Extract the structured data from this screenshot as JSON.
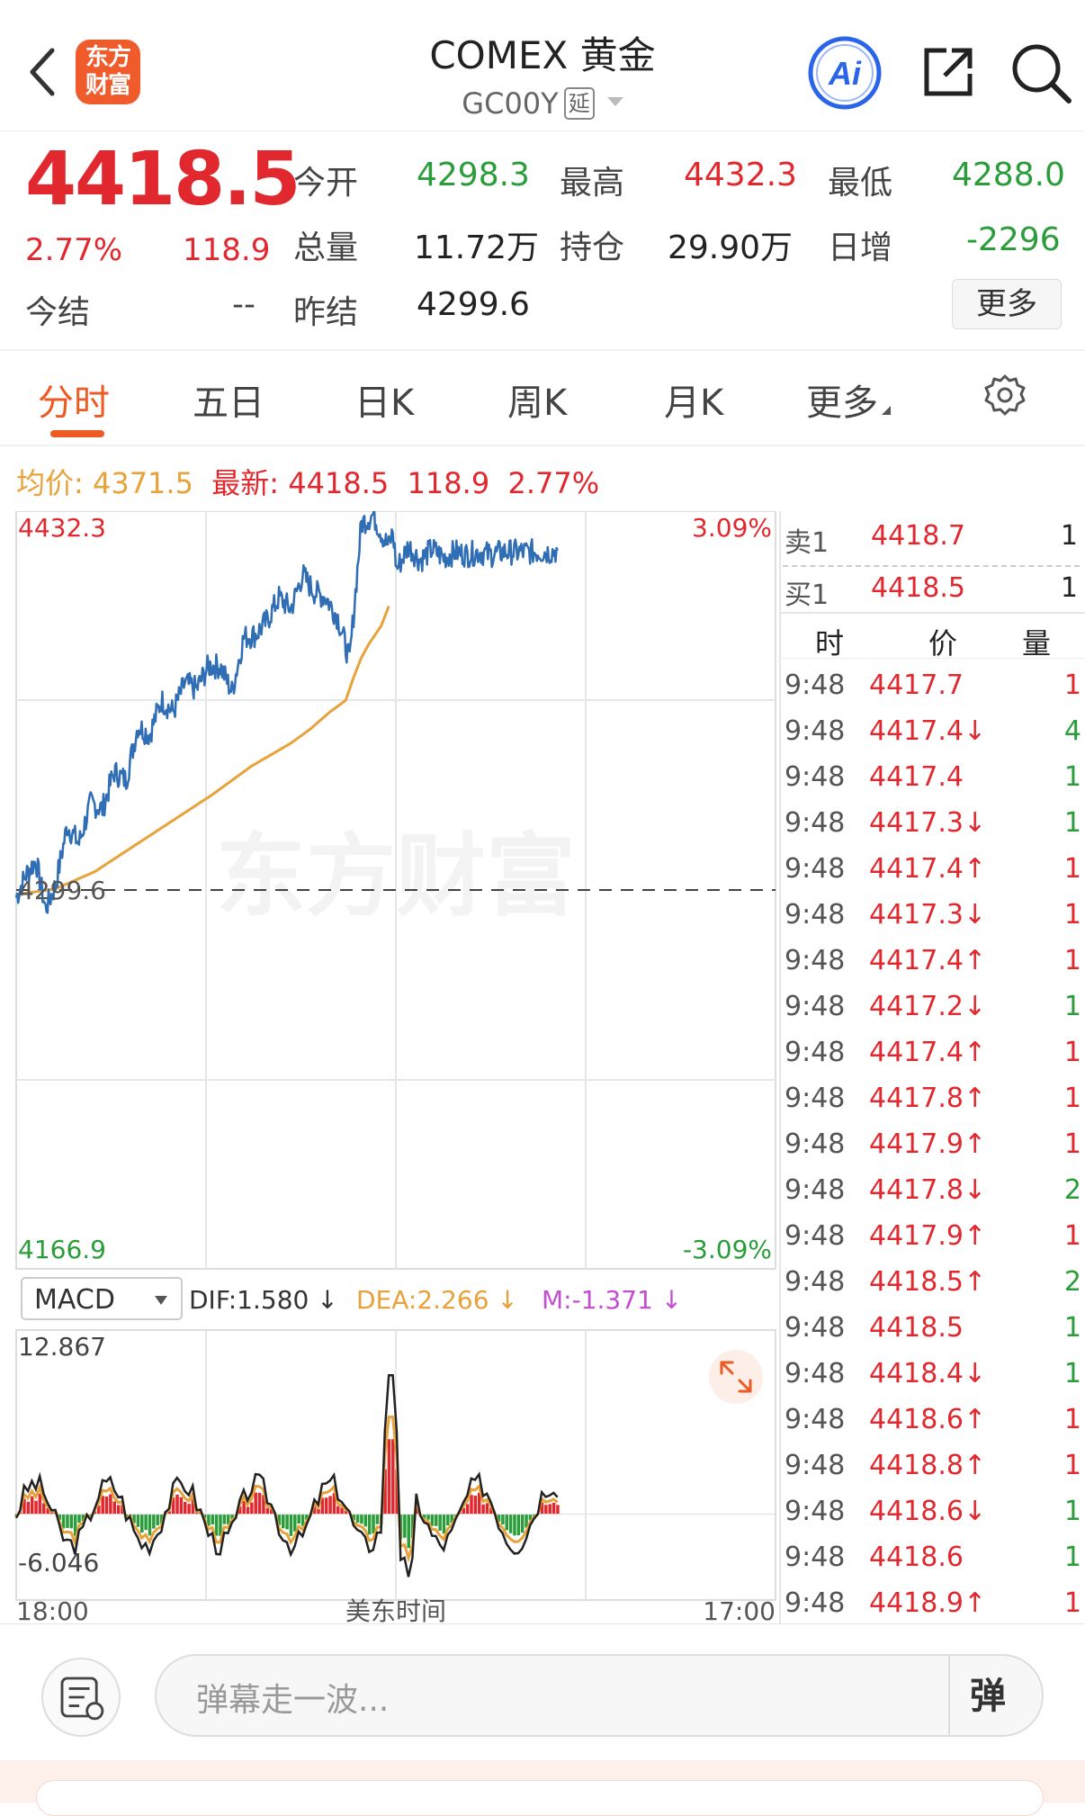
{
  "header": {
    "logo_line1": "东方",
    "logo_line2": "财富",
    "title": "COMEX 黄金",
    "code": "GC00Y",
    "delay_tag": "延",
    "ai_label": "Ai",
    "icons": [
      "back-arrow-icon",
      "share-icon",
      "search-icon",
      "ai-icon"
    ]
  },
  "quote": {
    "price": "4418.5",
    "change_pct": "2.77%",
    "change_amt": "118.9",
    "settle_label": "今结",
    "settle_value": "--",
    "open_label": "今开",
    "open_value": "4298.3",
    "high_label": "最高",
    "high_value": "4432.3",
    "low_label": "最低",
    "low_value": "4288.0",
    "volume_label": "总量",
    "volume_value": "11.72万",
    "oi_label": "持仓",
    "oi_value": "29.90万",
    "daily_label": "日增",
    "daily_value": "-2296",
    "prev_label": "昨结",
    "prev_value": "4299.6",
    "more_button": "更多"
  },
  "tabs": [
    "分时",
    "五日",
    "日K",
    "周K",
    "月K",
    "更多"
  ],
  "summary": {
    "avg_label": "均价:",
    "avg_value": "4371.5",
    "last_label": "最新:",
    "last_value": "4418.5",
    "last_change": "118.9",
    "last_pct": "2.77%"
  },
  "chart_data": {
    "type": "line",
    "price_axis": {
      "top": "4432.3",
      "bottom": "4166.9",
      "ref": "4299.6",
      "pct_top": "3.09%",
      "pct_bottom": "-3.09%"
    },
    "ylim": [
      4166.9,
      4432.3
    ],
    "reference": 4299.6,
    "x_start_label": "18:00",
    "x_mid_label": "美东时间",
    "x_end_label": "17:00",
    "watermark": "东方财富",
    "series": [
      {
        "name": "price",
        "color": "#2f6db5",
        "x": [
          0,
          5,
          10,
          15,
          20,
          26,
          32,
          38,
          44,
          50,
          56,
          62,
          68,
          74,
          80,
          86,
          92,
          98,
          104,
          110,
          116,
          122,
          128,
          134,
          140,
          146,
          152,
          158,
          164,
          170,
          176,
          182,
          188,
          190,
          192,
          194,
          200,
          206,
          212,
          218,
          224,
          230,
          236,
          242,
          248,
          254,
          260,
          266,
          272,
          276
        ],
        "y": [
          4297,
          4305,
          4310,
          4293,
          4301,
          4322,
          4316,
          4330,
          4328,
          4341,
          4338,
          4357,
          4354,
          4366,
          4362,
          4372,
          4370,
          4378,
          4378,
          4369,
          4388,
          4389,
          4394,
          4402,
          4398,
          4410,
          4404,
          4402,
          4395,
          4380,
          4428,
          4431,
          4422,
          4420,
          4425,
          4412,
          4420,
          4415,
          4419,
          4416,
          4418,
          4417,
          4418,
          4417,
          4418,
          4418,
          4418,
          4418,
          4418,
          4418.5
        ]
      },
      {
        "name": "avg",
        "color": "#e8a23b",
        "x": [
          0,
          20,
          40,
          60,
          80,
          100,
          120,
          140,
          150,
          160,
          168,
          172,
          176,
          180,
          186,
          190
        ],
        "y": [
          4298,
          4300,
          4306,
          4315,
          4324,
          4333,
          4343,
          4351,
          4356,
          4362,
          4366,
          4374,
          4381,
          4386,
          4392,
          4399
        ]
      }
    ]
  },
  "macd": {
    "selector": "MACD",
    "dif": "DIF:1.580 ↓",
    "dea": "DEA:2.266 ↓",
    "m": "M:-1.371 ↓",
    "top": "12.867",
    "bottom": "-6.046"
  },
  "orderbook": {
    "ask_label": "卖1",
    "ask_price": "4418.7",
    "ask_vol": "1",
    "bid_label": "买1",
    "bid_price": "4418.5",
    "bid_vol": "1",
    "col_time": "时",
    "col_price": "价",
    "col_vol": "量"
  },
  "trades": [
    {
      "t": "9:48",
      "p": "4417.7",
      "d": "",
      "v": "1",
      "vc": "red"
    },
    {
      "t": "9:48",
      "p": "4417.4",
      "d": "↓",
      "v": "4",
      "vc": "green"
    },
    {
      "t": "9:48",
      "p": "4417.4",
      "d": "",
      "v": "1",
      "vc": "green"
    },
    {
      "t": "9:48",
      "p": "4417.3",
      "d": "↓",
      "v": "1",
      "vc": "green"
    },
    {
      "t": "9:48",
      "p": "4417.4",
      "d": "↑",
      "v": "1",
      "vc": "red"
    },
    {
      "t": "9:48",
      "p": "4417.3",
      "d": "↓",
      "v": "1",
      "vc": "red"
    },
    {
      "t": "9:48",
      "p": "4417.4",
      "d": "↑",
      "v": "1",
      "vc": "red"
    },
    {
      "t": "9:48",
      "p": "4417.2",
      "d": "↓",
      "v": "1",
      "vc": "green"
    },
    {
      "t": "9:48",
      "p": "4417.4",
      "d": "↑",
      "v": "1",
      "vc": "red"
    },
    {
      "t": "9:48",
      "p": "4417.8",
      "d": "↑",
      "v": "1",
      "vc": "red"
    },
    {
      "t": "9:48",
      "p": "4417.9",
      "d": "↑",
      "v": "1",
      "vc": "red"
    },
    {
      "t": "9:48",
      "p": "4417.8",
      "d": "↓",
      "v": "2",
      "vc": "green"
    },
    {
      "t": "9:48",
      "p": "4417.9",
      "d": "↑",
      "v": "1",
      "vc": "red"
    },
    {
      "t": "9:48",
      "p": "4418.5",
      "d": "↑",
      "v": "2",
      "vc": "green"
    },
    {
      "t": "9:48",
      "p": "4418.5",
      "d": "",
      "v": "1",
      "vc": "green"
    },
    {
      "t": "9:48",
      "p": "4418.4",
      "d": "↓",
      "v": "1",
      "vc": "green"
    },
    {
      "t": "9:48",
      "p": "4418.6",
      "d": "↑",
      "v": "1",
      "vc": "red"
    },
    {
      "t": "9:48",
      "p": "4418.8",
      "d": "↑",
      "v": "1",
      "vc": "red"
    },
    {
      "t": "9:48",
      "p": "4418.6",
      "d": "↓",
      "v": "1",
      "vc": "green"
    },
    {
      "t": "9:48",
      "p": "4418.6",
      "d": "",
      "v": "1",
      "vc": "green"
    },
    {
      "t": "9:48",
      "p": "4418.9",
      "d": "↑",
      "v": "1",
      "vc": "red"
    }
  ],
  "bottom": {
    "placeholder": "弹幕走一波...",
    "danmu_button": "弹"
  },
  "colors": {
    "up": "#e0282e",
    "down": "#2a9d3a",
    "accent": "#ee5a24",
    "price_line": "#2f6db5",
    "avg_line": "#e8a23b"
  }
}
